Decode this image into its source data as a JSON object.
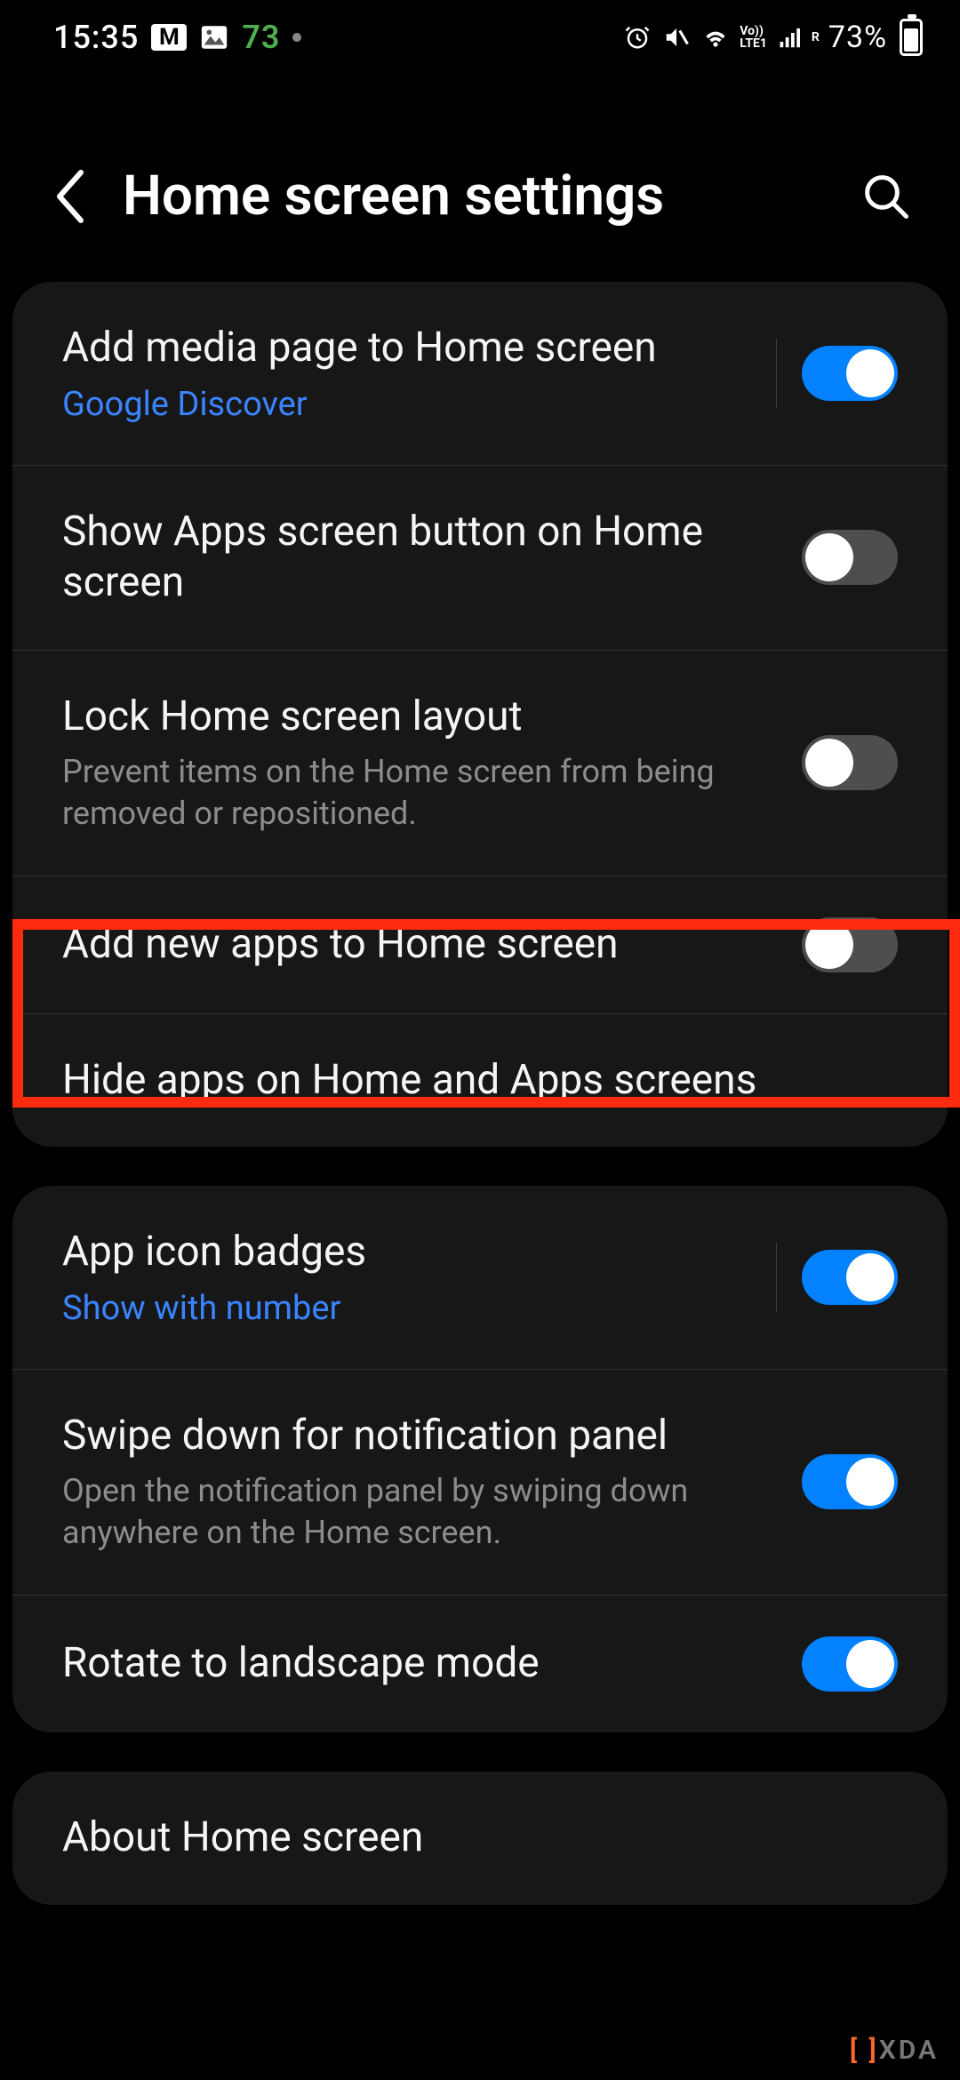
{
  "status": {
    "time": "15:35",
    "left_icons": {
      "gmail": "M",
      "green_number": "73"
    },
    "battery_percent": "73%"
  },
  "header": {
    "title": "Home screen settings"
  },
  "groups": [
    {
      "rows": [
        {
          "title": "Add media page to Home screen",
          "sub_link": "Google Discover",
          "toggle": "on",
          "with_separator": true
        },
        {
          "title": "Show Apps screen button on Home screen",
          "toggle": "off"
        },
        {
          "title": "Lock Home screen layout",
          "sub_desc": "Prevent items on the Home screen from being removed or repositioned.",
          "toggle": "off"
        },
        {
          "title": "Add new apps to Home screen",
          "toggle": "off",
          "highlighted": true
        },
        {
          "title": "Hide apps on Home and Apps screens"
        }
      ]
    },
    {
      "rows": [
        {
          "title": "App icon badges",
          "sub_link": "Show with number",
          "toggle": "on",
          "with_separator": true
        },
        {
          "title": "Swipe down for notification panel",
          "sub_desc": "Open the notification panel by swiping down anywhere on the Home screen.",
          "toggle": "on"
        },
        {
          "title": "Rotate to landscape mode",
          "toggle": "on"
        }
      ]
    },
    {
      "rows": [
        {
          "title": "About Home screen"
        }
      ]
    }
  ],
  "watermark": "XDA"
}
